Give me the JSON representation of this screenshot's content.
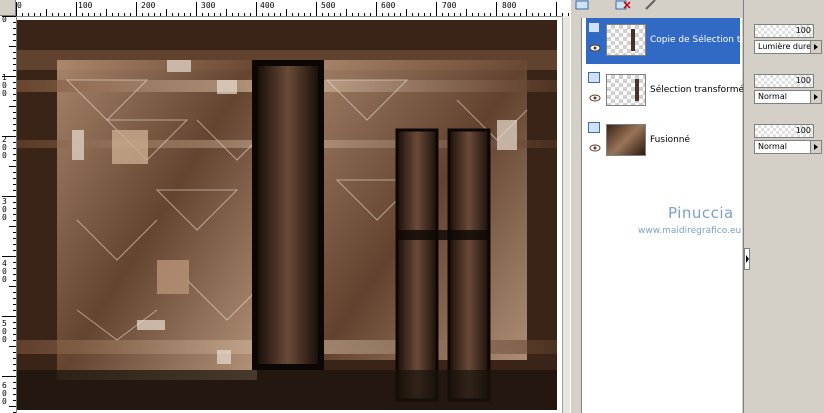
{
  "ruler": {
    "h_labels": [
      "0",
      "100",
      "200",
      "300",
      "400",
      "500",
      "600",
      "700",
      "800"
    ],
    "v_labels": [
      "0",
      "100",
      "200",
      "300",
      "400",
      "500",
      "600"
    ]
  },
  "layers": [
    {
      "name": "Copie de Sélection tran",
      "selected": true,
      "opacity": "100",
      "blend": "Lumière dure"
    },
    {
      "name": "Sélection transformée",
      "selected": false,
      "opacity": "100",
      "blend": "Normal"
    },
    {
      "name": "Fusionné",
      "selected": false,
      "opacity": "100",
      "blend": "Normal"
    }
  ],
  "watermark": {
    "title": "Pinuccia",
    "url": "www.maidiregrafico.eu"
  },
  "colors": {
    "selection": "#316ac5",
    "panel": "#d4d0c8",
    "watermark": "#7da0c8"
  }
}
